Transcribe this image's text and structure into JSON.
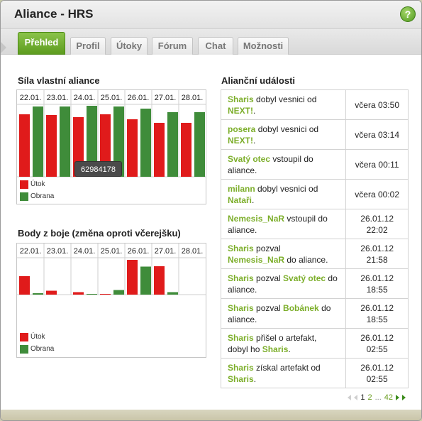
{
  "window": {
    "title": "Aliance - HRS",
    "help_label": "?"
  },
  "tabs": [
    {
      "label": "Přehled",
      "active": true
    },
    {
      "label": "Profil",
      "active": false
    },
    {
      "label": "Útoky",
      "active": false
    },
    {
      "label": "Fórum",
      "active": false
    },
    {
      "label": "Chat",
      "active": false
    },
    {
      "label": "Možnosti",
      "active": false
    }
  ],
  "colors": {
    "attack": "#e01b1b",
    "defense": "#3f8c3a",
    "accent": "#7cae2a"
  },
  "strength_chart": {
    "title": "Síla vlastní aliance",
    "tooltip": "62984178",
    "legend": [
      "Útok",
      "Obrana"
    ]
  },
  "battle_chart": {
    "title": "Body z boje (změna oproti včerejšku)",
    "legend": [
      "Útok",
      "Obrana"
    ]
  },
  "chart_data": [
    {
      "type": "bar",
      "title": "Síla vlastní aliance",
      "categories": [
        "22.01.",
        "23.01.",
        "24.01.",
        "25.01.",
        "26.01.",
        "27.01.",
        "28.01."
      ],
      "series": [
        {
          "name": "Útok",
          "values": [
            88,
            87,
            84,
            88,
            81,
            76,
            76
          ]
        },
        {
          "name": "Obrana",
          "values": [
            99,
            99,
            100,
            99,
            96,
            91,
            91
          ]
        }
      ],
      "ylim": [
        0,
        100
      ]
    },
    {
      "type": "bar",
      "title": "Body z boje (změna oproti včerejšku)",
      "categories": [
        "22.01.",
        "23.01.",
        "24.01.",
        "25.01.",
        "26.01.",
        "27.01.",
        "28.01."
      ],
      "series": [
        {
          "name": "Útok",
          "values": [
            52,
            11,
            7,
            2,
            98,
            80,
            0
          ]
        },
        {
          "name": "Obrana",
          "values": [
            4,
            0,
            2,
            13,
            79,
            7,
            0
          ]
        }
      ],
      "ylim": [
        0,
        100
      ]
    }
  ],
  "events": {
    "title": "Alianční události",
    "rows": [
      {
        "parts": [
          {
            "t": "Sharis",
            "hl": true
          },
          {
            "t": " dobyl vesnici od ",
            "hl": false
          },
          {
            "t": "NEXT!",
            "hl": true
          },
          {
            "t": ".",
            "hl": false
          }
        ],
        "time": "včera 03:50"
      },
      {
        "parts": [
          {
            "t": "posera",
            "hl": true
          },
          {
            "t": " dobyl vesnici od ",
            "hl": false
          },
          {
            "t": "NEXT!",
            "hl": true
          },
          {
            "t": ".",
            "hl": false
          }
        ],
        "time": "včera 03:14"
      },
      {
        "parts": [
          {
            "t": "Svatý otec",
            "hl": true
          },
          {
            "t": " vstoupil do aliance.",
            "hl": false
          }
        ],
        "time": "včera 00:11"
      },
      {
        "parts": [
          {
            "t": "milann",
            "hl": true
          },
          {
            "t": " dobyl vesnici od ",
            "hl": false
          },
          {
            "t": "Nataři",
            "hl": true
          },
          {
            "t": ".",
            "hl": false
          }
        ],
        "time": "včera 00:02"
      },
      {
        "parts": [
          {
            "t": "Nemesis_NaR",
            "hl": true
          },
          {
            "t": " vstoupil do aliance.",
            "hl": false
          }
        ],
        "time": "26.01.12 22:02"
      },
      {
        "parts": [
          {
            "t": "Sharis",
            "hl": true
          },
          {
            "t": " pozval ",
            "hl": false
          },
          {
            "t": "Nemesis_NaR",
            "hl": true
          },
          {
            "t": " do aliance.",
            "hl": false
          }
        ],
        "time": "26.01.12 21:58"
      },
      {
        "parts": [
          {
            "t": "Sharis",
            "hl": true
          },
          {
            "t": " pozval ",
            "hl": false
          },
          {
            "t": "Svatý otec",
            "hl": true
          },
          {
            "t": " do aliance.",
            "hl": false
          }
        ],
        "time": "26.01.12 18:55"
      },
      {
        "parts": [
          {
            "t": "Sharis",
            "hl": true
          },
          {
            "t": " pozval ",
            "hl": false
          },
          {
            "t": "Bobánek",
            "hl": true
          },
          {
            "t": " do aliance.",
            "hl": false
          }
        ],
        "time": "26.01.12 18:55"
      },
      {
        "parts": [
          {
            "t": "Sharis",
            "hl": true
          },
          {
            "t": " přišel o artefakt, dobyl ho ",
            "hl": false
          },
          {
            "t": "Sharis",
            "hl": true
          },
          {
            "t": ".",
            "hl": false
          }
        ],
        "time": "26.01.12 02:55"
      },
      {
        "parts": [
          {
            "t": "Sharis",
            "hl": true
          },
          {
            "t": " získal artefakt od ",
            "hl": false
          },
          {
            "t": "Sharis",
            "hl": true
          },
          {
            "t": ".",
            "hl": false
          }
        ],
        "time": "26.01.12 02:55"
      }
    ]
  },
  "pager": {
    "pages": [
      "1",
      "2",
      "...",
      "42"
    ],
    "current": "1"
  }
}
